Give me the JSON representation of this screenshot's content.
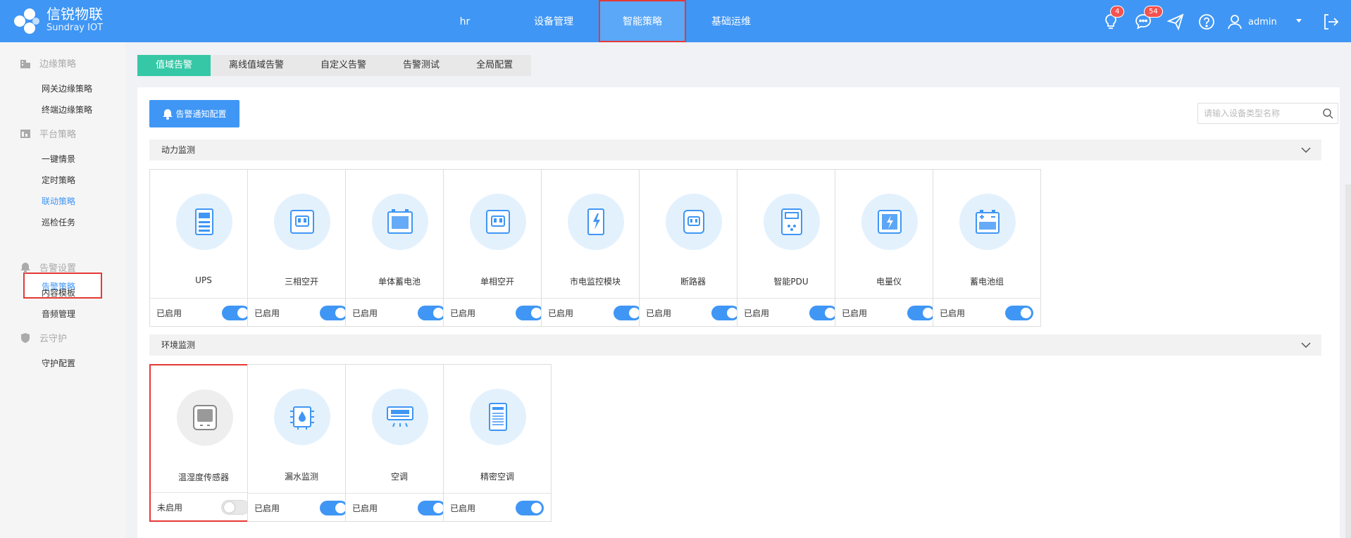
{
  "brand": {
    "name_cn": "信锐物联",
    "name_en": "Sundray IOT"
  },
  "nav": {
    "items": [
      "hr",
      "设备管理",
      "智能策略",
      "基础运维"
    ],
    "active": "智能策略"
  },
  "header": {
    "bulb_badge": "4",
    "msg_badge": "54",
    "user": "admin"
  },
  "sidebar": {
    "groups": [
      {
        "label": "边缘策略",
        "icon": "building-icon",
        "items": [
          "网关边缘策略",
          "终端边缘策略"
        ]
      },
      {
        "label": "平台策略",
        "icon": "platform-icon",
        "items": [
          "一键情景",
          "定时策略",
          "联动策略",
          "巡检任务",
          "告警策略"
        ]
      },
      {
        "label": "告警设置",
        "icon": "bell-icon",
        "items": [
          "内容模板",
          "音频管理"
        ]
      },
      {
        "label": "云守护",
        "icon": "shield-icon",
        "items": [
          "守护配置"
        ]
      }
    ],
    "active": "告警策略"
  },
  "tabs": [
    "值域告警",
    "离线值域告警",
    "自定义告警",
    "告警测试",
    "全局配置"
  ],
  "active_tab": "值域告警",
  "toolbar": {
    "notify_button": "告警通知配置",
    "search_placeholder": "请输入设备类型名称"
  },
  "sections": [
    {
      "title": "动力监测",
      "cards": [
        {
          "name": "UPS",
          "status": "已启用",
          "enabled": true,
          "icon": "ups-icon"
        },
        {
          "name": "三相空开",
          "status": "已启用",
          "enabled": true,
          "icon": "breaker-three-phase-icon"
        },
        {
          "name": "单体蓄电池",
          "status": "已启用",
          "enabled": true,
          "icon": "battery-cell-icon"
        },
        {
          "name": "单相空开",
          "status": "已启用",
          "enabled": true,
          "icon": "breaker-single-phase-icon"
        },
        {
          "name": "市电监控模块",
          "status": "已启用",
          "enabled": true,
          "icon": "mains-monitor-icon"
        },
        {
          "name": "断路器",
          "status": "已启用",
          "enabled": true,
          "icon": "circuit-breaker-icon"
        },
        {
          "name": "智能PDU",
          "status": "已启用",
          "enabled": true,
          "icon": "pdu-icon"
        },
        {
          "name": "电量仪",
          "status": "已启用",
          "enabled": true,
          "icon": "power-meter-icon"
        },
        {
          "name": "蓄电池组",
          "status": "已启用",
          "enabled": true,
          "icon": "battery-pack-icon"
        }
      ]
    },
    {
      "title": "环境监测",
      "cards": [
        {
          "name": "温湿度传感器",
          "status": "未启用",
          "enabled": false,
          "icon": "temp-humidity-sensor-icon"
        },
        {
          "name": "漏水监测",
          "status": "已启用",
          "enabled": true,
          "icon": "water-leak-icon"
        },
        {
          "name": "空调",
          "status": "已启用",
          "enabled": true,
          "icon": "air-conditioner-icon"
        },
        {
          "name": "精密空调",
          "status": "已启用",
          "enabled": true,
          "icon": "precision-ac-icon"
        }
      ]
    }
  ],
  "colors": {
    "primary": "#3f96f5",
    "tab_active": "#36c8a6",
    "highlight": "#e53935",
    "icon_bg": "#e3f1fd"
  }
}
